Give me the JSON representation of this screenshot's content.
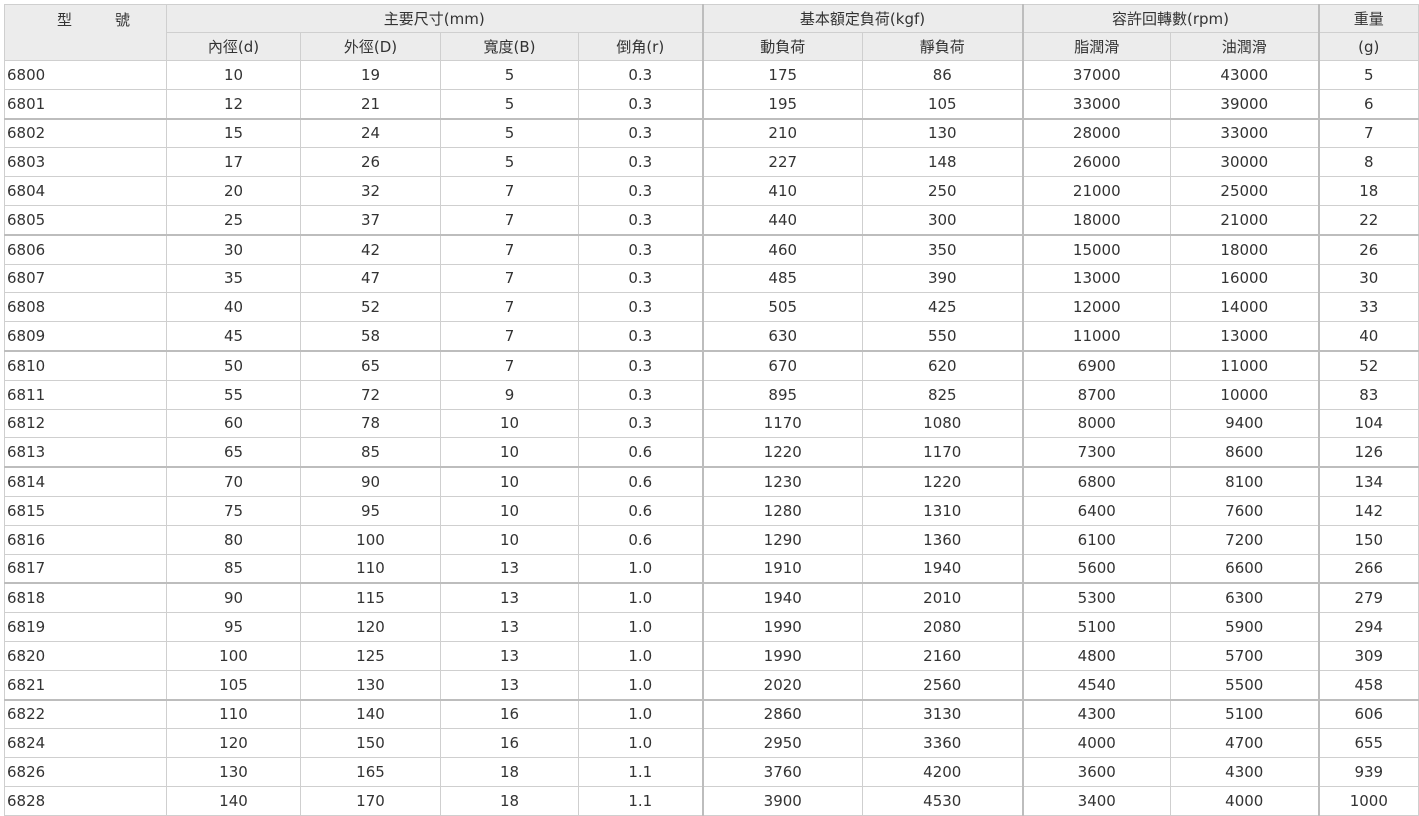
{
  "table": {
    "header_groups": {
      "model": "型　號",
      "dimensions": "主要尺寸(mm)",
      "load": "基本額定負荷(kgf)",
      "speed": "容許回轉數(rpm)",
      "weight": "重量"
    },
    "sub_headers": {
      "inner_d": "內徑(d)",
      "outer_d": "外徑(D)",
      "width_b": "寬度(B)",
      "chamfer_r": "倒角(r)",
      "dynamic": "動負荷",
      "static": "靜負荷",
      "grease": "脂潤滑",
      "oil": "油潤滑",
      "weight_unit": "(g)"
    },
    "rows": [
      [
        "6800",
        "10",
        "19",
        "5",
        "0.3",
        "175",
        "86",
        "37000",
        "43000",
        "5"
      ],
      [
        "6801",
        "12",
        "21",
        "5",
        "0.3",
        "195",
        "105",
        "33000",
        "39000",
        "6"
      ],
      [
        "6802",
        "15",
        "24",
        "5",
        "0.3",
        "210",
        "130",
        "28000",
        "33000",
        "7"
      ],
      [
        "6803",
        "17",
        "26",
        "5",
        "0.3",
        "227",
        "148",
        "26000",
        "30000",
        "8"
      ],
      [
        "6804",
        "20",
        "32",
        "7",
        "0.3",
        "410",
        "250",
        "21000",
        "25000",
        "18"
      ],
      [
        "6805",
        "25",
        "37",
        "7",
        "0.3",
        "440",
        "300",
        "18000",
        "21000",
        "22"
      ],
      [
        "6806",
        "30",
        "42",
        "7",
        "0.3",
        "460",
        "350",
        "15000",
        "18000",
        "26"
      ],
      [
        "6807",
        "35",
        "47",
        "7",
        "0.3",
        "485",
        "390",
        "13000",
        "16000",
        "30"
      ],
      [
        "6808",
        "40",
        "52",
        "7",
        "0.3",
        "505",
        "425",
        "12000",
        "14000",
        "33"
      ],
      [
        "6809",
        "45",
        "58",
        "7",
        "0.3",
        "630",
        "550",
        "11000",
        "13000",
        "40"
      ],
      [
        "6810",
        "50",
        "65",
        "7",
        "0.3",
        "670",
        "620",
        "6900",
        "11000",
        "52"
      ],
      [
        "6811",
        "55",
        "72",
        "9",
        "0.3",
        "895",
        "825",
        "8700",
        "10000",
        "83"
      ],
      [
        "6812",
        "60",
        "78",
        "10",
        "0.3",
        "1170",
        "1080",
        "8000",
        "9400",
        "104"
      ],
      [
        "6813",
        "65",
        "85",
        "10",
        "0.6",
        "1220",
        "1170",
        "7300",
        "8600",
        "126"
      ],
      [
        "6814",
        "70",
        "90",
        "10",
        "0.6",
        "1230",
        "1220",
        "6800",
        "8100",
        "134"
      ],
      [
        "6815",
        "75",
        "95",
        "10",
        "0.6",
        "1280",
        "1310",
        "6400",
        "7600",
        "142"
      ],
      [
        "6816",
        "80",
        "100",
        "10",
        "0.6",
        "1290",
        "1360",
        "6100",
        "7200",
        "150"
      ],
      [
        "6817",
        "85",
        "110",
        "13",
        "1.0",
        "1910",
        "1940",
        "5600",
        "6600",
        "266"
      ],
      [
        "6818",
        "90",
        "115",
        "13",
        "1.0",
        "1940",
        "2010",
        "5300",
        "6300",
        "279"
      ],
      [
        "6819",
        "95",
        "120",
        "13",
        "1.0",
        "1990",
        "2080",
        "5100",
        "5900",
        "294"
      ],
      [
        "6820",
        "100",
        "125",
        "13",
        "1.0",
        "1990",
        "2160",
        "4800",
        "5700",
        "309"
      ],
      [
        "6821",
        "105",
        "130",
        "13",
        "1.0",
        "2020",
        "2560",
        "4540",
        "5500",
        "458"
      ],
      [
        "6822",
        "110",
        "140",
        "16",
        "1.0",
        "2860",
        "3130",
        "4300",
        "5100",
        "606"
      ],
      [
        "6824",
        "120",
        "150",
        "16",
        "1.0",
        "2950",
        "3360",
        "4000",
        "4700",
        "655"
      ],
      [
        "6826",
        "130",
        "165",
        "18",
        "1.1",
        "3760",
        "4200",
        "3600",
        "4300",
        "939"
      ],
      [
        "6828",
        "140",
        "170",
        "18",
        "1.1",
        "3900",
        "4530",
        "3400",
        "4000",
        "1000"
      ]
    ]
  }
}
